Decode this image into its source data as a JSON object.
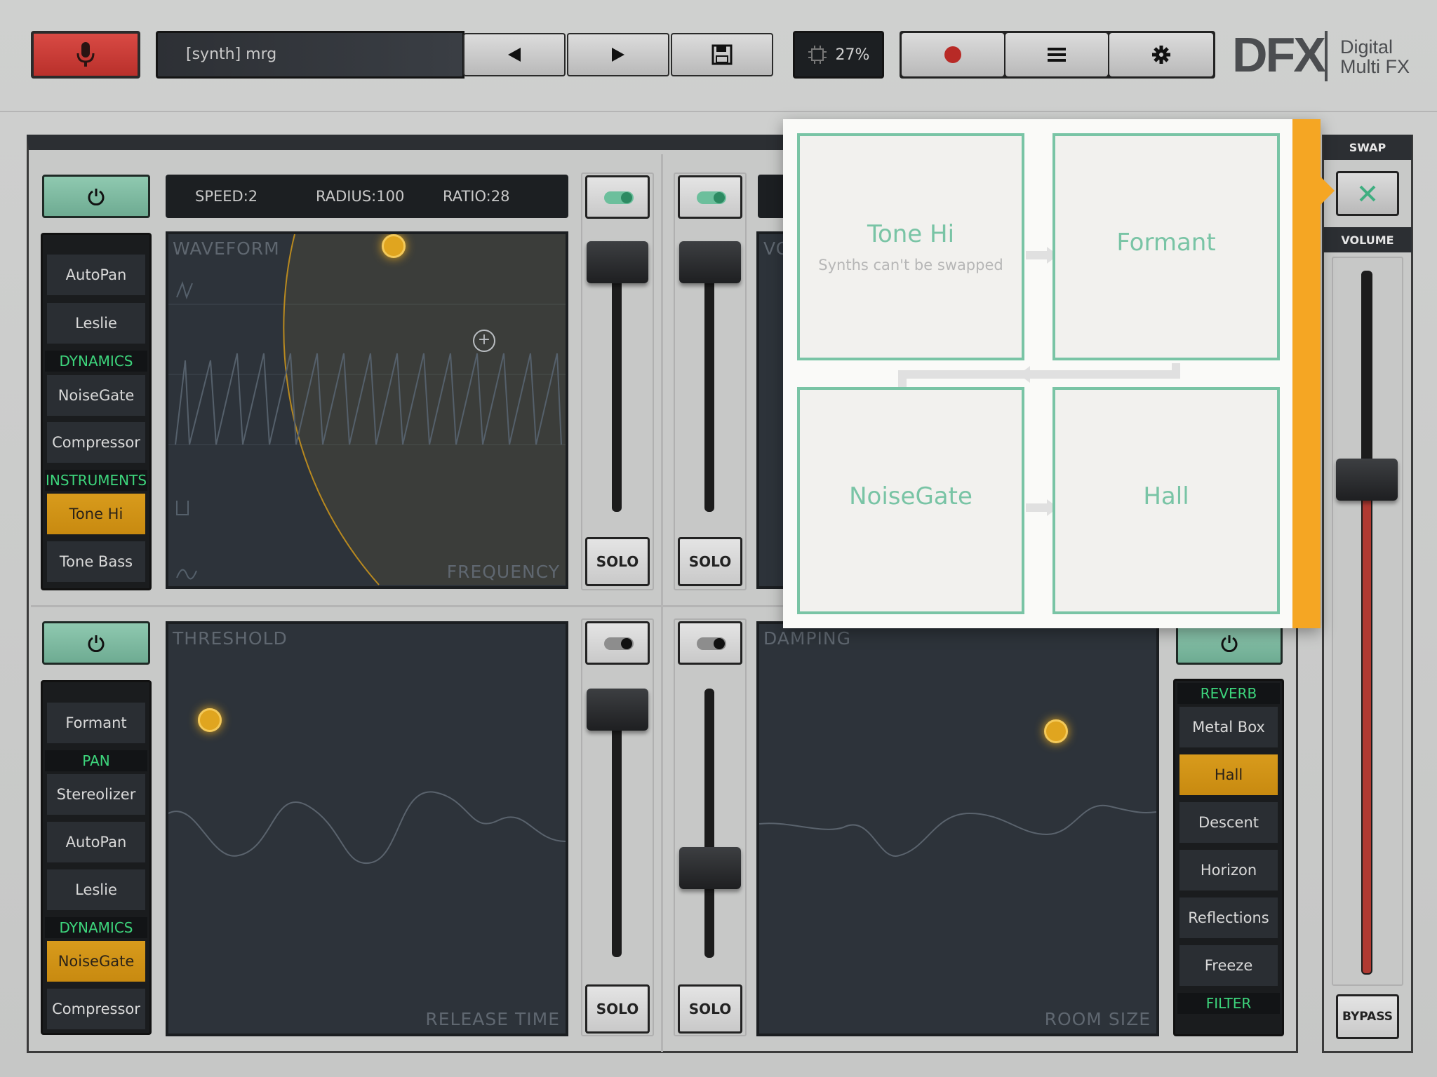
{
  "header": {
    "preset_name": "[synth] mrg",
    "cpu": "27%",
    "logo": "DFX",
    "logo_sub1": "Digital",
    "logo_sub2": "Multi FX"
  },
  "icons": {
    "mic": "microphone-icon",
    "prev": "play-left-icon",
    "next": "play-right-icon",
    "save": "floppy-icon",
    "cpu": "chip-icon",
    "record": "record-icon",
    "menu": "menu-icon",
    "settings": "gear-icon"
  },
  "colors": {
    "accent": "#f5a623",
    "green": "#79c4a5",
    "record": "#c0302c",
    "selected": "#d89b1c"
  },
  "slot1": {
    "params": [
      "SPEED:2",
      "RADIUS:100",
      "RATIO:28"
    ],
    "pad_label_top": "WAVEFORM",
    "pad_label_bottom": "FREQUENCY",
    "list": [
      {
        "type": "item",
        "label": "AutoPan"
      },
      {
        "type": "item",
        "label": "Leslie"
      },
      {
        "type": "head",
        "label": "DYNAMICS"
      },
      {
        "type": "item",
        "label": "NoiseGate"
      },
      {
        "type": "item",
        "label": "Compressor"
      },
      {
        "type": "head",
        "label": "INSTRUMENTS"
      },
      {
        "type": "item",
        "label": "Tone Hi",
        "selected": true
      },
      {
        "type": "item",
        "label": "Tone Bass"
      }
    ]
  },
  "slot3": {
    "pad_label_top": "THRESHOLD",
    "pad_label_bottom": "RELEASE TIME",
    "list": [
      {
        "type": "item",
        "label": "Formant"
      },
      {
        "type": "head",
        "label": "PAN"
      },
      {
        "type": "item",
        "label": "Stereolizer"
      },
      {
        "type": "item",
        "label": "AutoPan"
      },
      {
        "type": "item",
        "label": "Leslie"
      },
      {
        "type": "head",
        "label": "DYNAMICS"
      },
      {
        "type": "item",
        "label": "NoiseGate",
        "selected": true
      },
      {
        "type": "item",
        "label": "Compressor"
      }
    ]
  },
  "slot4": {
    "pad_label_top": "DAMPING",
    "pad_label_bottom": "ROOM SIZE",
    "list": [
      {
        "type": "head",
        "label": "REVERB"
      },
      {
        "type": "item",
        "label": "Metal Box"
      },
      {
        "type": "item",
        "label": "Hall",
        "selected": true
      },
      {
        "type": "item",
        "label": "Descent"
      },
      {
        "type": "item",
        "label": "Horizon"
      },
      {
        "type": "item",
        "label": "Reflections"
      },
      {
        "type": "item",
        "label": "Freeze"
      },
      {
        "type": "head",
        "label": "FILTER"
      }
    ]
  },
  "slot2_partial": {
    "pad_label_top": "VO"
  },
  "solo_label": "SOLO",
  "right_rail": {
    "swap": "SWAP",
    "volume": "VOLUME",
    "bypass": "BYPASS",
    "volume_level": 0.73
  },
  "swap_popup": {
    "boxes": [
      {
        "title": "Tone Hi",
        "subtitle": "Synths can't be swapped"
      },
      {
        "title": "Formant",
        "subtitle": ""
      },
      {
        "title": "NoiseGate",
        "subtitle": ""
      },
      {
        "title": "Hall",
        "subtitle": ""
      }
    ]
  }
}
